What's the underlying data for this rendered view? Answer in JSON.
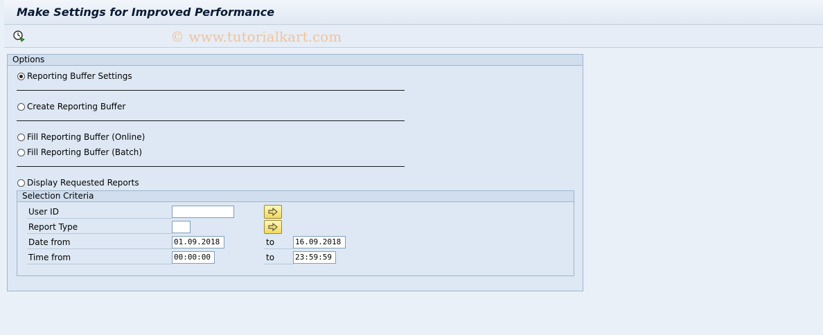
{
  "header": {
    "title": "Make Settings for Improved Performance",
    "watermark": "© www.tutorialkart.com"
  },
  "toolbar": {
    "execute_icon": "execute-clock-icon"
  },
  "options": {
    "title": "Options",
    "radios": [
      {
        "label": "Reporting Buffer Settings",
        "checked": true
      },
      {
        "label": "Create Reporting Buffer",
        "checked": false
      },
      {
        "label": "Fill Reporting Buffer (Online)",
        "checked": false
      },
      {
        "label": "Fill Reporting Buffer (Batch)",
        "checked": false
      },
      {
        "label": "Display Requested Reports",
        "checked": false
      }
    ]
  },
  "selection": {
    "title": "Selection Criteria",
    "fields": [
      {
        "label": "User ID",
        "value": ""
      },
      {
        "label": "Report Type",
        "value": ""
      },
      {
        "label": "Date from",
        "value": "01.09.2018",
        "to_label": "to",
        "to_value": "16.09.2018"
      },
      {
        "label": "Time from",
        "value": "00:00:00",
        "to_label": "to",
        "to_value": "23:59:59"
      }
    ],
    "multi_select_icon": "arrow-right-multiple-selection-icon"
  },
  "colors": {
    "background": "#eaf0f8",
    "group_background": "#dde8f4",
    "button_yellow": "#f0d860"
  }
}
